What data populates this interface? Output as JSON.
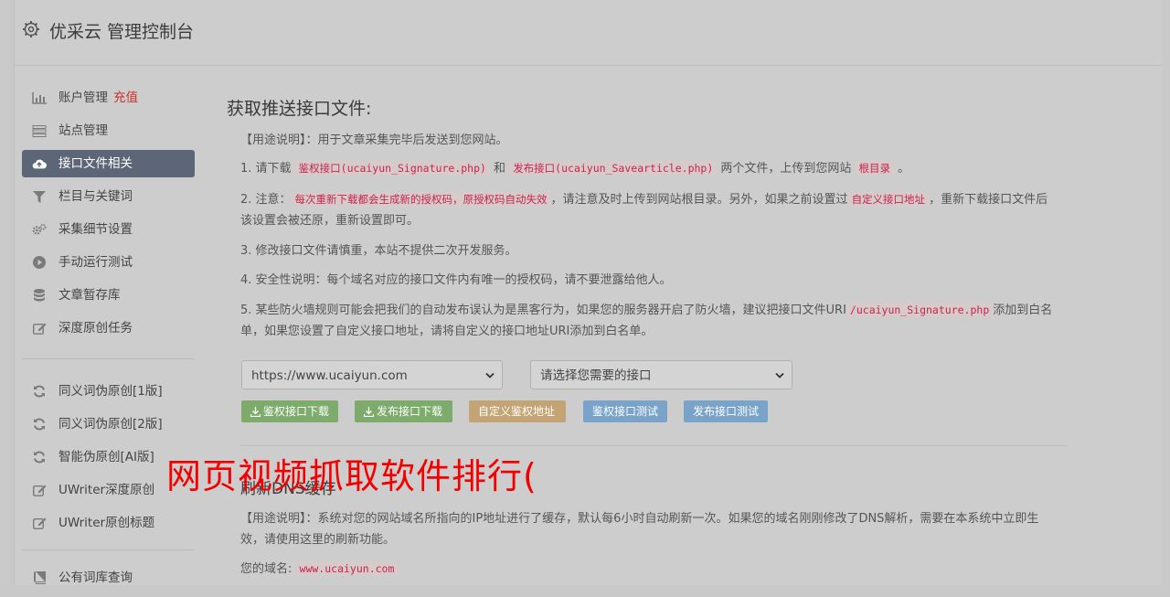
{
  "header": {
    "title": "优采云 管理控制台"
  },
  "sidebar": {
    "items": [
      {
        "label": "账户管理",
        "badge": "充值"
      },
      {
        "label": "站点管理"
      },
      {
        "label": "接口文件相关"
      },
      {
        "label": "栏目与关键词"
      },
      {
        "label": "采集细节设置"
      },
      {
        "label": "手动运行测试"
      },
      {
        "label": "文章暂存库"
      },
      {
        "label": "深度原创任务"
      },
      {
        "label": "同义词伪原创[1版]"
      },
      {
        "label": "同义词伪原创[2版]"
      },
      {
        "label": "智能伪原创[AI版]"
      },
      {
        "label": "UWriter深度原创"
      },
      {
        "label": "UWriter原创标题"
      },
      {
        "label": "公有词库查询"
      }
    ]
  },
  "main": {
    "heading": "获取推送接口文件:",
    "usage": "【用途说明】：用于文章采集完毕后发送到您网站。",
    "p1": {
      "a": "1. 请下载 ",
      "code1": "鉴权接口(ucaiyun_Signature.php)",
      "b": " 和 ",
      "code2": "发布接口(ucaiyun_Savearticle.php)",
      "c": " 两个文件，上传到您网站 ",
      "code3": "根目录",
      "d": " 。"
    },
    "p2": {
      "a": "2. 注意：",
      "code1": "每次重新下载都会生成新的授权码，原授权码自动失效",
      "b": "，请注意及时上传到网站根目录。另外，如果之前设置过",
      "code2": "自定义接口地址",
      "c": "，重新下载接口文件后该设置会被还原，重新设置即可。"
    },
    "p3": "3. 修改接口文件请慎重，本站不提供二次开发服务。",
    "p4": "4. 安全性说明：每个域名对应的接口文件内有唯一的授权码，请不要泄露给他人。",
    "p5": {
      "a": "5. 某些防火墙规则可能会把我们的自动发布误认为是黑客行为，如果您的服务器开启了防火墙，建议把接口文件URI",
      "code1": "/ucaiyun_Signature.php",
      "b": "添加到白名单，如果您设置了自定义接口地址，请将自定义的接口地址URI添加到白名单。"
    },
    "site_select": "https://www.ucaiyun.com",
    "api_select": "请选择您需要的接口",
    "buttons": {
      "dl_sign": "鉴权接口下载",
      "dl_publish": "发布接口下载",
      "custom_sign": "自定义鉴权地址",
      "test_sign": "鉴权接口测试",
      "test_publish": "发布接口测试"
    },
    "dns_heading": "刷新DNS缓存",
    "dns_usage": "【用途说明】：系统对您的网站域名所指向的IP地址进行了缓存，默认每6小时自动刷新一次。如果您的域名刚刚修改了DNS解析，需要在本系统中立即生效，请使用这里的刷新功能。",
    "domain_label": "您的域名:",
    "domain_value": "www.ucaiyun.com"
  },
  "overlay_text": "网页视频抓取软件排行(",
  "colors": {
    "active_bg": "#5d6676",
    "code_red": "#c7254e",
    "overlay_red": "#f50000"
  }
}
